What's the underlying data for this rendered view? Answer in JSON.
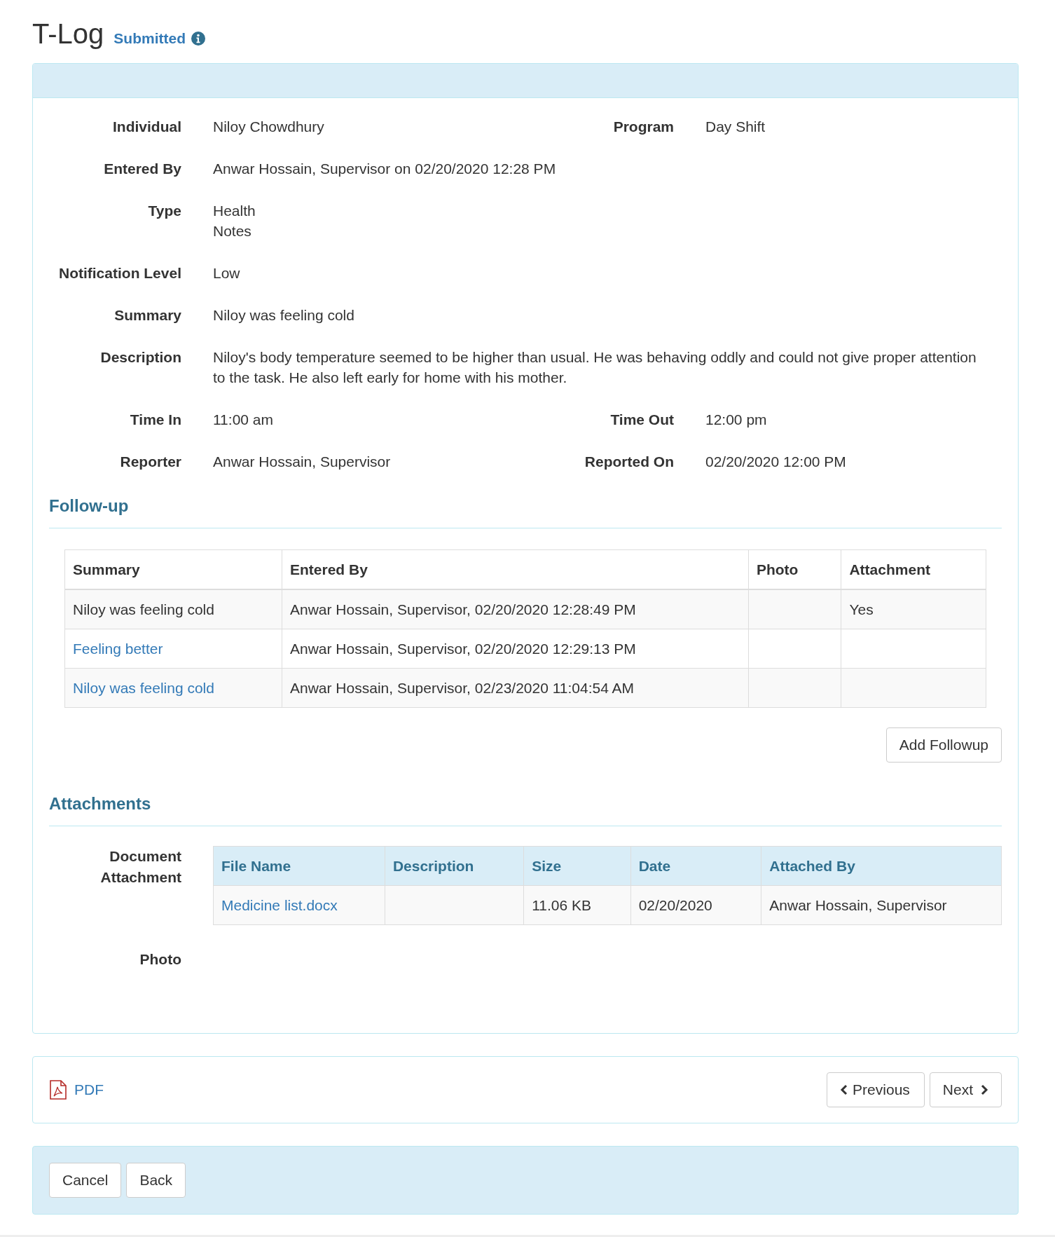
{
  "title": "T-Log",
  "status": "Submitted",
  "details": [
    {
      "fields": [
        {
          "label": "Individual",
          "lines": [
            "Niloy Chowdhury"
          ]
        },
        {
          "label": "Program",
          "lines": [
            "Day Shift"
          ]
        }
      ]
    },
    {
      "fields": [
        {
          "label": "Entered By",
          "lines": [
            "Anwar Hossain, Supervisor on 02/20/2020 12:28 PM"
          ]
        }
      ]
    },
    {
      "fields": [
        {
          "label": "Type",
          "lines": [
            "Health",
            "Notes"
          ]
        }
      ]
    },
    {
      "fields": [
        {
          "label": "Notification Level",
          "lines": [
            "Low"
          ]
        }
      ]
    },
    {
      "fields": [
        {
          "label": "Summary",
          "lines": [
            "Niloy was feeling cold"
          ]
        }
      ]
    },
    {
      "fields": [
        {
          "label": "Description",
          "lines": [
            "Niloy's body temperature seemed to be higher than usual. He was behaving oddly and could not give proper attention to the task. He also left early for home with his mother."
          ]
        }
      ]
    },
    {
      "fields": [
        {
          "label": "Time In",
          "lines": [
            "11:00 am"
          ]
        },
        {
          "label": "Time Out",
          "lines": [
            "12:00 pm"
          ]
        }
      ]
    },
    {
      "fields": [
        {
          "label": "Reporter",
          "lines": [
            "Anwar Hossain, Supervisor"
          ]
        },
        {
          "label": "Reported On",
          "lines": [
            "02/20/2020 12:00 PM"
          ]
        }
      ]
    }
  ],
  "followup": {
    "heading": "Follow-up",
    "columns": [
      "Summary",
      "Entered By",
      "Photo",
      "Attachment"
    ],
    "rows": [
      {
        "summary": "Niloy was feeling cold",
        "link": false,
        "entered_by": "Anwar Hossain, Supervisor, 02/20/2020 12:28:49 PM",
        "attachment": "Yes"
      },
      {
        "summary": "Feeling better",
        "link": true,
        "entered_by": "Anwar Hossain, Supervisor, 02/20/2020 12:29:13 PM"
      },
      {
        "summary": "Niloy was feeling cold",
        "link": true,
        "entered_by": "Anwar Hossain, Supervisor, 02/23/2020 11:04:54 AM"
      }
    ],
    "button": "Add Followup"
  },
  "attachments": {
    "heading": "Attachments",
    "label": "Document Attachment",
    "columns": [
      "File Name",
      "Description",
      "Size",
      "Date",
      "Attached By"
    ],
    "rows": [
      {
        "file_name": "Medicine list.docx",
        "size": "11.06 KB",
        "date": "02/20/2020",
        "attached_by": "Anwar Hossain, Supervisor"
      }
    ],
    "photo_label": "Photo"
  },
  "footer": {
    "pdf": "PDF",
    "previous": "Previous",
    "next": "Next"
  },
  "actions": [
    "Cancel",
    "Back"
  ]
}
